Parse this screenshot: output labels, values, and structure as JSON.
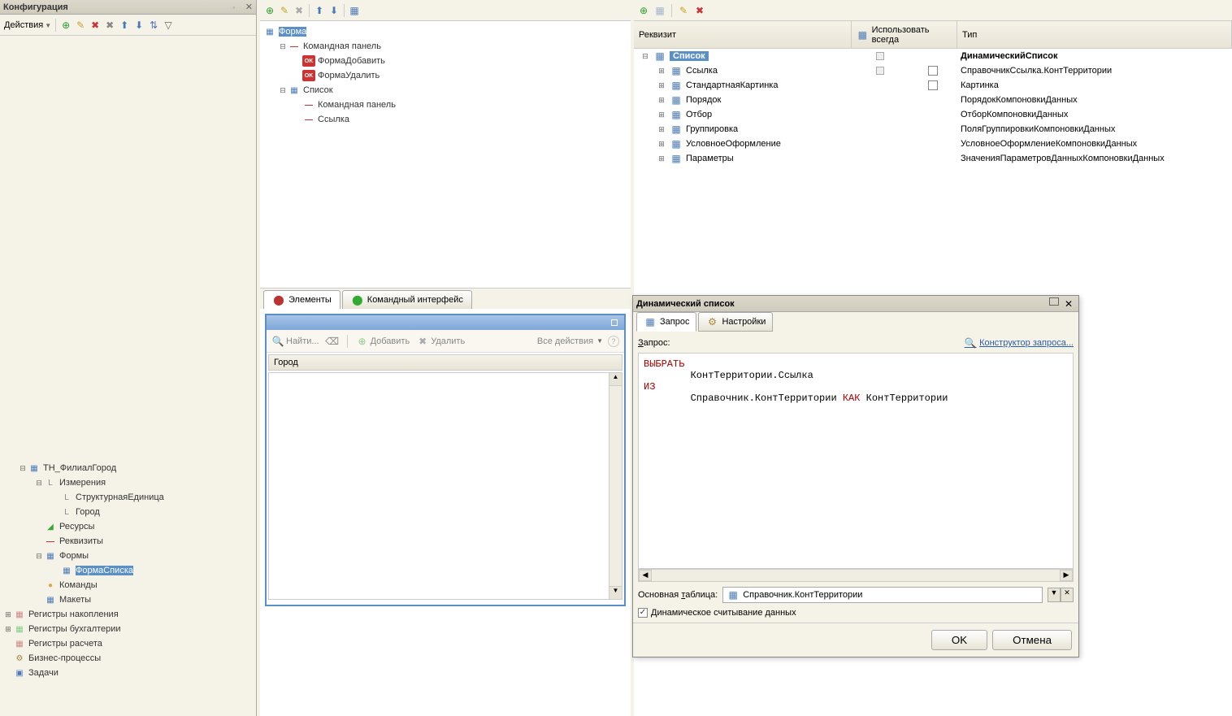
{
  "leftPanel": {
    "title": "Конфигурация",
    "actionsLabel": "Действия",
    "tree": {
      "root": "ТН_ФилиалГород",
      "dims": "Измерения",
      "dim1": "СтруктурнаяЕдиница",
      "dim2": "Город",
      "resources": "Ресурсы",
      "attribs": "Реквизиты",
      "forms": "Формы",
      "form1": "ФормаСписка",
      "commands": "Команды",
      "templates": "Макеты",
      "accum": "Регистры накопления",
      "accounting": "Регистры бухгалтерии",
      "calc": "Регистры расчета",
      "bp": "Бизнес-процессы",
      "tasks": "Задачи"
    }
  },
  "midPanel": {
    "tree": {
      "root": "Форма",
      "cmdPanel": "Командная панель",
      "formAdd": "ФормаДобавить",
      "formDel": "ФормаУдалить",
      "list": "Список",
      "cmdPanel2": "Командная панель",
      "link": "Ссылка"
    },
    "tabs": {
      "elements": "Элементы",
      "cmdInterface": "Командный интерфейс"
    },
    "preview": {
      "find": "Найти...",
      "add": "Добавить",
      "delete": "Удалить",
      "allActions": "Все действия",
      "colCity": "Город"
    }
  },
  "rightPanel": {
    "headers": {
      "attrib": "Реквизит",
      "useAlways": "Использовать всегда",
      "type": "Тип"
    },
    "rows": [
      {
        "name": "Список",
        "type": "ДинамическийСписок",
        "indent": 0,
        "selected": true,
        "bold": true
      },
      {
        "name": "Ссылка",
        "type": "СправочникСсылка.КонтТерритории",
        "indent": 1,
        "check": true
      },
      {
        "name": "СтандартнаяКартинка",
        "type": "Картинка",
        "indent": 1,
        "check": true
      },
      {
        "name": "Порядок",
        "type": "ПорядокКомпоновкиДанных",
        "indent": 1
      },
      {
        "name": "Отбор",
        "type": "ОтборКомпоновкиДанных",
        "indent": 1
      },
      {
        "name": "Группировка",
        "type": "ПоляГруппировкиКомпоновкиДанных",
        "indent": 1
      },
      {
        "name": "УсловноеОформление",
        "type": "УсловноеОформлениеКомпоновкиДанных",
        "indent": 1
      },
      {
        "name": "Параметры",
        "type": "ЗначенияПараметровДанныхКомпоновкиДанных",
        "indent": 1
      }
    ]
  },
  "dialog": {
    "title": "Динамический список",
    "tabQuery": "Запрос",
    "tabSettings": "Настройки",
    "queryLabel": "Запрос:",
    "constructor": "Конструктор запроса...",
    "code": {
      "select": "ВЫБРАТЬ",
      "field": "        КонтТерритории.Ссылка",
      "from": "ИЗ",
      "table": "        Справочник.КонтТерритории ",
      "as": "КАК",
      "alias": " КонтТерритории"
    },
    "mainTableLabel": "Основная таблица:",
    "mainTableValue": "Справочник.КонтТерритории",
    "dynReadLabel": "Динамическое считывание данных",
    "ok": "OK",
    "cancel": "Отмена"
  }
}
